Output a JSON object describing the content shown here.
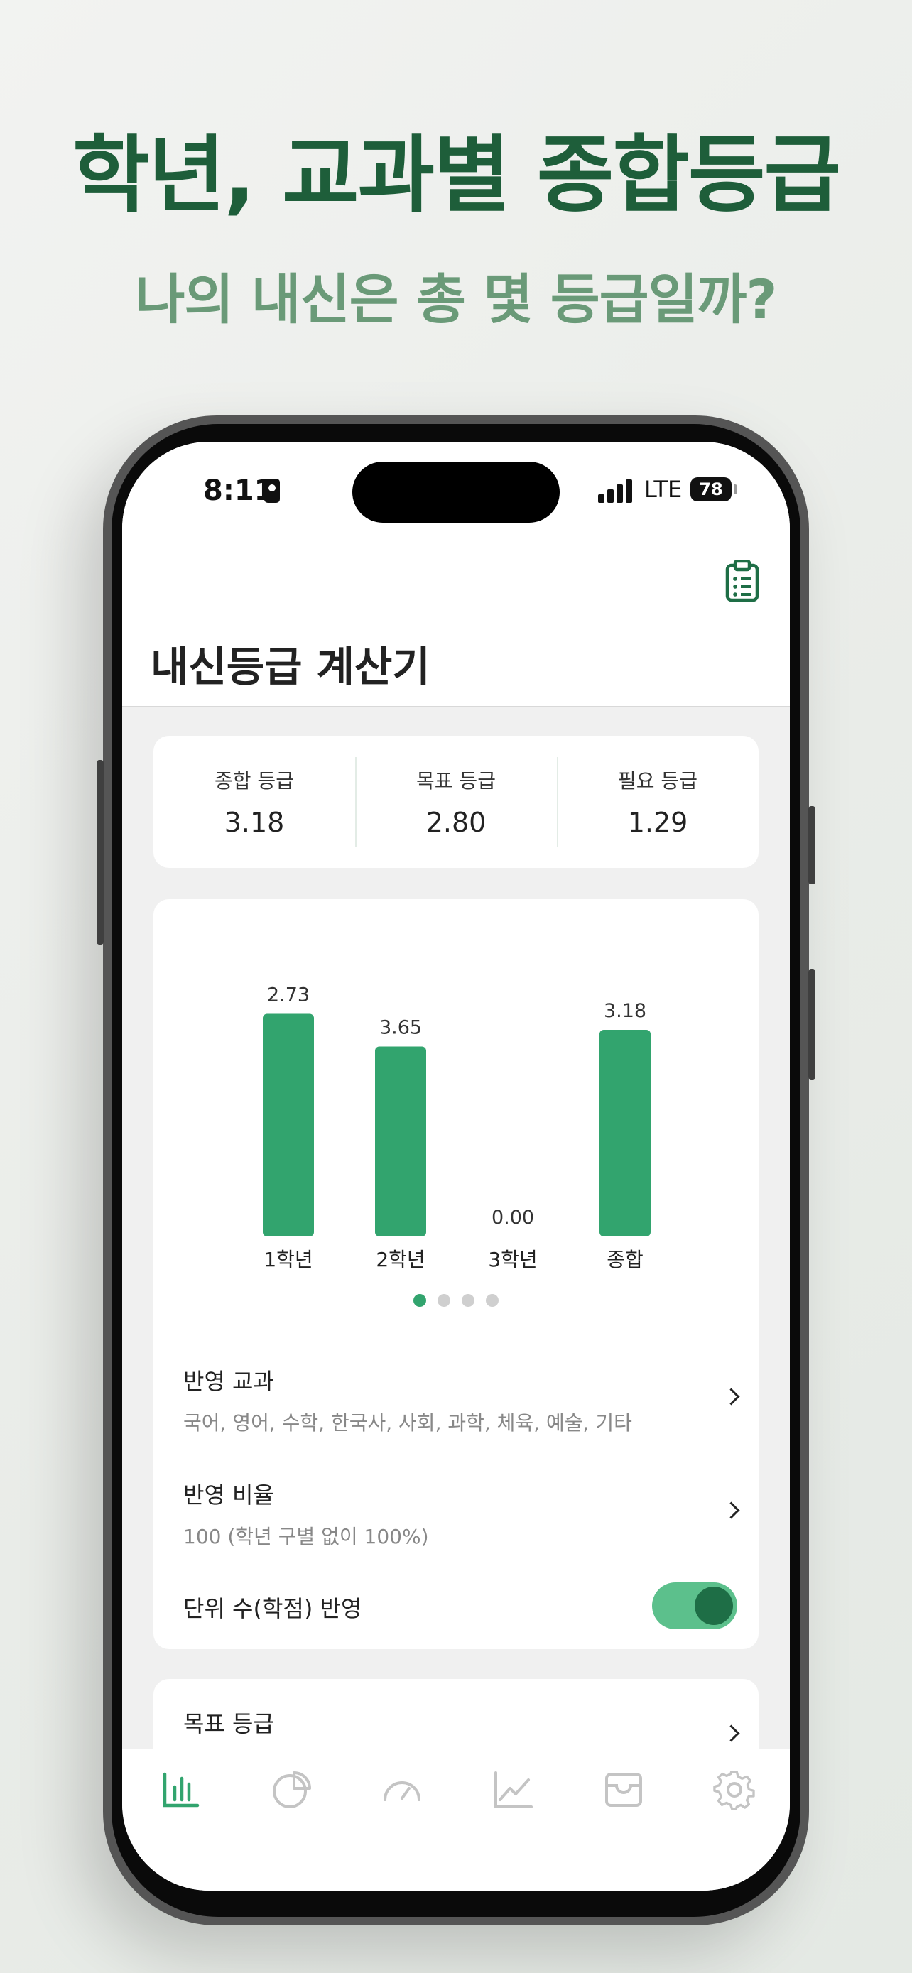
{
  "promo": {
    "headline": "학년, 교과별 종합등급",
    "subline": "나의 내신은 총 몇 등급일까?"
  },
  "status_bar": {
    "time": "8:11",
    "network": "LTE",
    "battery": "78"
  },
  "header": {
    "title": "내신등급 계산기",
    "action_icon": "clipboard-list-icon"
  },
  "summary": {
    "items": [
      {
        "label": "종합 등급",
        "value": "3.18"
      },
      {
        "label": "목표 등급",
        "value": "2.80"
      },
      {
        "label": "필요 등급",
        "value": "1.29"
      }
    ]
  },
  "chart_data": {
    "type": "bar",
    "categories": [
      "1학년",
      "2학년",
      "3학년",
      "종합"
    ],
    "values": [
      2.73,
      3.65,
      0.0,
      3.18
    ],
    "value_labels": [
      "2.73",
      "3.65",
      "0.00",
      "3.18"
    ],
    "color": "#32a46e",
    "note": "inverted grade scale: lower grade value draws a taller bar",
    "scale": {
      "best": 1,
      "worst": 9
    },
    "grid": false,
    "legend": "none"
  },
  "pager": {
    "count": 4,
    "active": 0
  },
  "settings": {
    "subjects_title": "반영 교과",
    "subjects_value": "국어, 영어, 수학, 한국사, 사회, 과학, 체육, 예술, 기타",
    "ratio_title": "반영 비율",
    "ratio_value": "100 (학년 구별 없이 100%)",
    "credit_title": "단위 수(학점) 반영",
    "credit_enabled": true
  },
  "goal": {
    "title": "목표 등급"
  },
  "tab_bar": {
    "active_index": 0,
    "tabs": [
      "bar-chart-icon",
      "pie-chart-icon",
      "gauge-icon",
      "line-chart-icon",
      "inbox-icon",
      "gear-icon"
    ]
  },
  "colors": {
    "accent": "#32a46e",
    "headline": "#1e5e3a",
    "subline": "#6a9a78",
    "inactive_icon": "#c4c4c4"
  }
}
